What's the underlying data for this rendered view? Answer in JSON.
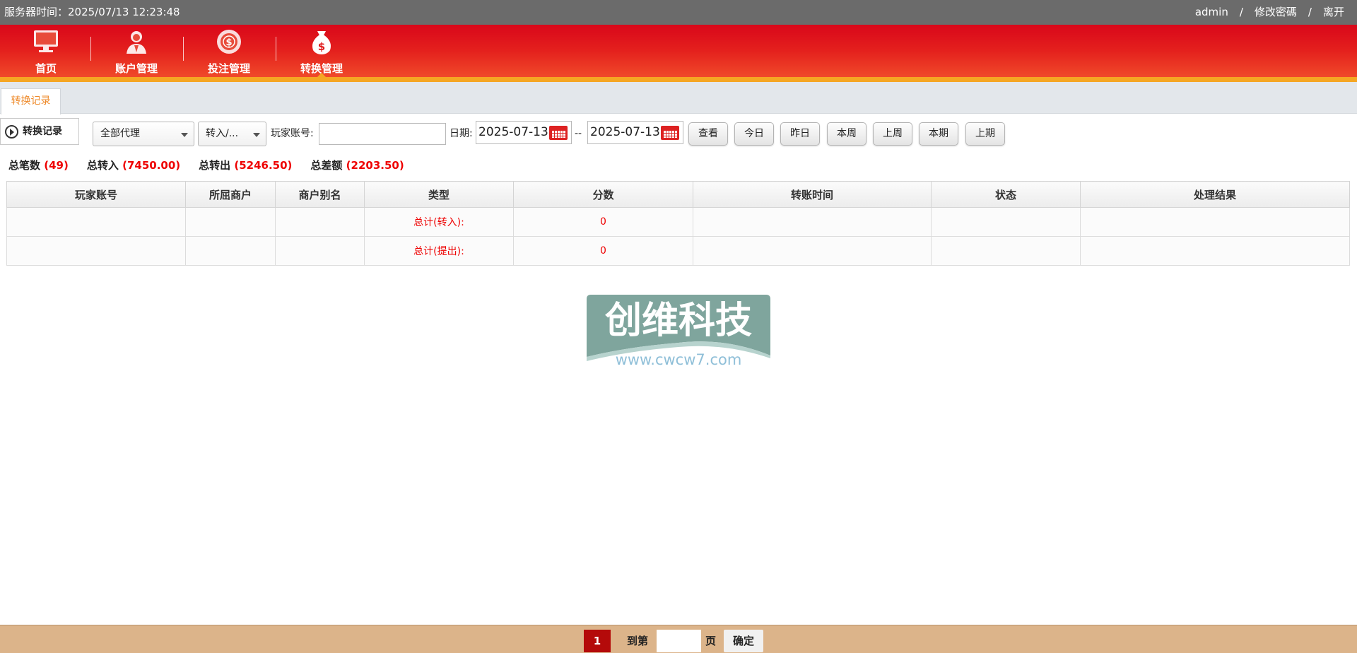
{
  "topbar": {
    "server_time": "服务器时间：2025/07/13 12:23:48",
    "user": "admin",
    "sep1": "/",
    "change_password": "修改密碼",
    "sep2": "/",
    "logout": "离开"
  },
  "nav": {
    "items": [
      {
        "label": "首页",
        "icon": "monitor-icon"
      },
      {
        "label": "账户管理",
        "icon": "user-icon"
      },
      {
        "label": "投注管理",
        "icon": "chip-icon"
      },
      {
        "label": "转换管理",
        "icon": "money-bag-icon",
        "active": true
      }
    ]
  },
  "tabs": {
    "active": "转换记录"
  },
  "toolbar": {
    "section_label": "转换记录",
    "agent_select": "全部代理",
    "type_select": "转入/...",
    "account_label": "玩家账号:",
    "account_value": "",
    "date_label": "日期:",
    "date_from": "2025-07-13",
    "date_sep": "--",
    "date_to": "2025-07-13",
    "buttons": [
      "查看",
      "今日",
      "昨日",
      "本周",
      "上周",
      "本期",
      "上期"
    ]
  },
  "summary": {
    "count_label": "总笔数",
    "count_value": "(49)",
    "in_label": "总转入",
    "in_value": "(7450.00)",
    "out_label": "总转出",
    "out_value": "(5246.50)",
    "diff_label": "总差额",
    "diff_value": "(2203.50)"
  },
  "table": {
    "headers": [
      "玩家账号",
      "所屈商户",
      "商户别名",
      "类型",
      "分数",
      "转账时间",
      "状态",
      "处理结果"
    ],
    "rows": [
      {
        "type": "总计(转入):",
        "score": "0"
      },
      {
        "type": "总计(提出):",
        "score": "0"
      }
    ]
  },
  "watermark": {
    "title": "创维科技",
    "url": "www.cwcw7.com"
  },
  "pager": {
    "current": "1",
    "goto_label": "到第",
    "page_label": "页",
    "confirm": "确定"
  },
  "colors": {
    "nav_red": "#e01a1c",
    "accent_orange": "#f5a623",
    "value_red": "#ee0000",
    "pager_bg": "#dcb48a"
  }
}
